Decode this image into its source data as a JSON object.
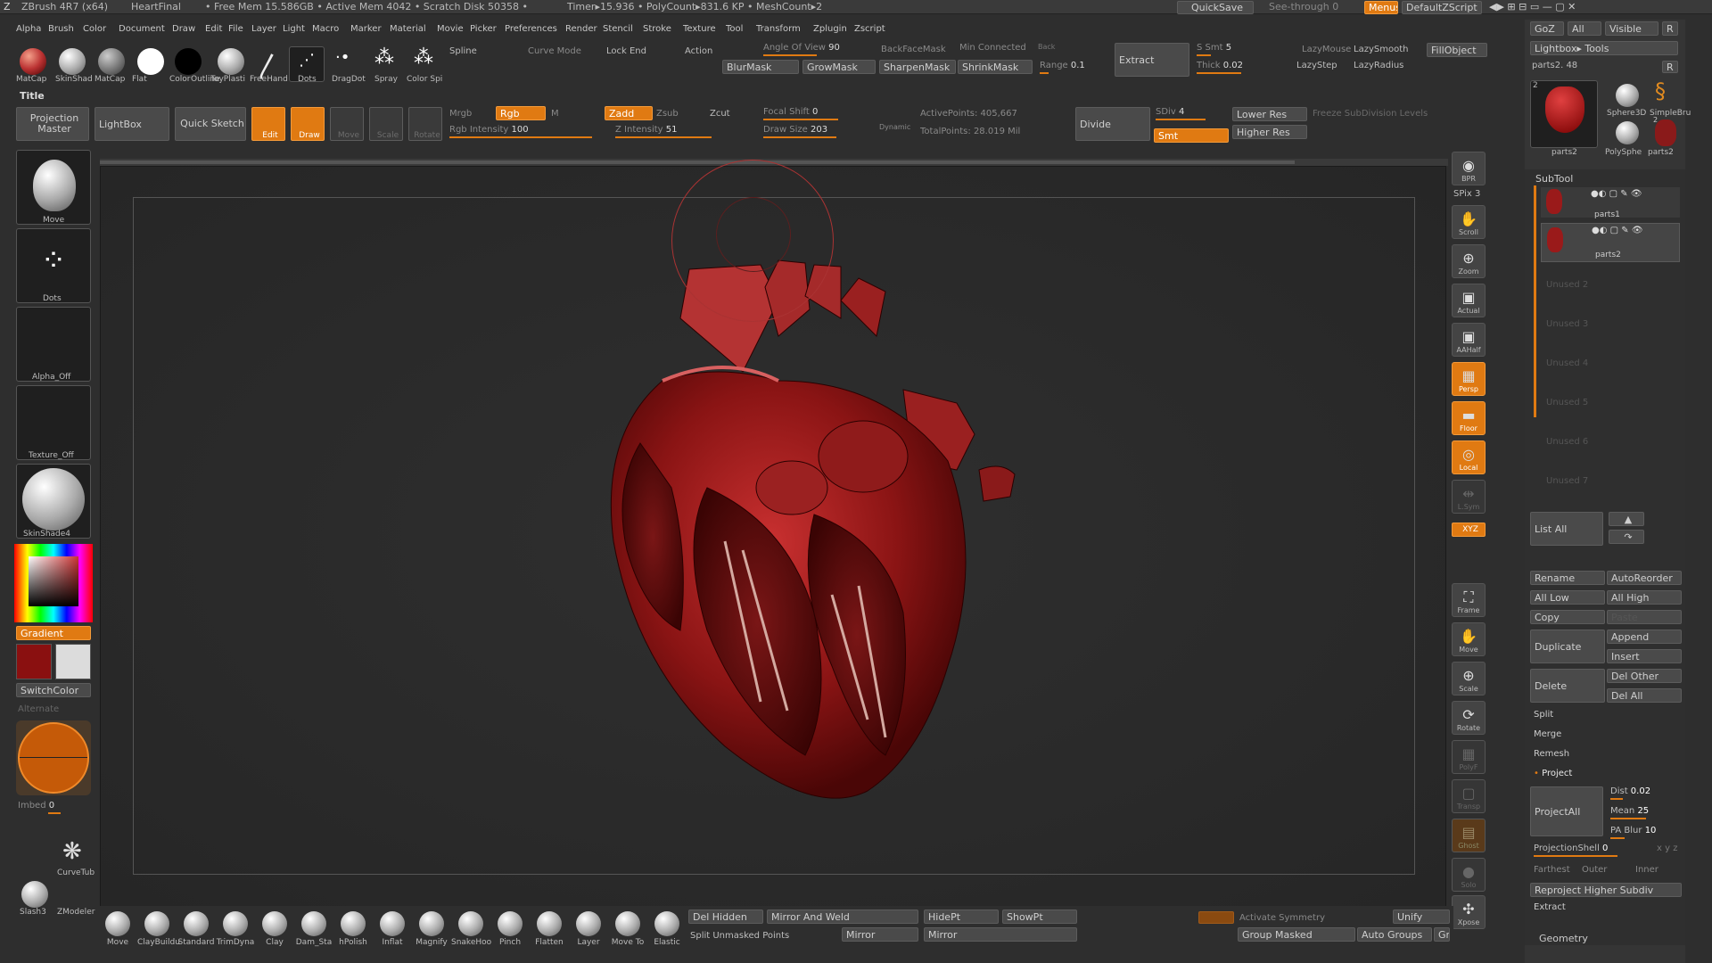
{
  "topbar": {
    "app": "ZBrush 4R7 (x64)",
    "doc": "HeartFinal",
    "mem": "• Free Mem 15.586GB • Active Mem 4042 • Scratch Disk 50358 •",
    "timer": "Timer▸15.936 • PolyCount▸831.6 KP • MeshCount▸2",
    "quicksave": "QuickSave",
    "see_through": "See-through  0",
    "menus": "Menus",
    "script": "DefaultZScript"
  },
  "menu": [
    "Alpha",
    "Brush",
    "Color",
    "Document",
    "Draw",
    "Edit",
    "File",
    "Layer",
    "Light",
    "Macro",
    "Marker",
    "Material",
    "Movie",
    "Picker",
    "Preferences",
    "Render",
    "Stencil",
    "Stroke",
    "Texture",
    "Tool",
    "Transform",
    "Zplugin",
    "Zscript"
  ],
  "shelf": {
    "items": [
      "MatCap",
      "SkinShad",
      "MatCap",
      "Flat",
      "Color",
      "Outline",
      "ToyPlasti",
      "FreeHand",
      "Dots",
      "DragDot",
      "Spray",
      "Color Spi"
    ]
  },
  "toolbar1": {
    "spline": "Spline",
    "curve_mode": "Curve Mode",
    "lock_end": "Lock End",
    "action": "Action",
    "angle": "Angle Of View",
    "angle_val": "90",
    "backface": "BackFaceMask",
    "min_conn": "Min Connected",
    "back": "Back",
    "extract": "Extract",
    "smt": "S Smt",
    "smt_val": "5",
    "lazymouse": "LazyMouse",
    "lazysmooth": "LazySmooth",
    "fillobject": "FillObject",
    "lazyradius": "LazyRadius",
    "blurmask": "BlurMask",
    "growmask": "GrowMask",
    "sharpenmask": "SharpenMask",
    "shrinkmask": "ShrinkMask",
    "range": "Range",
    "range_val": "0.1",
    "thick": "Thick",
    "thick_val": "0.02",
    "lazystep": "LazyStep"
  },
  "title_label": "Title",
  "toolbar2": {
    "projection_master": "Projection Master",
    "lightbox": "LightBox",
    "quick_sketch": "Quick Sketch",
    "edit": "Edit",
    "draw": "Draw",
    "move": "Move",
    "scale": "Scale",
    "rotate": "Rotate",
    "mrgb": "Mrgb",
    "rgb": "Rgb",
    "m": "M",
    "zadd": "Zadd",
    "zsub": "Zsub",
    "zcut": "Zcut",
    "rgb_intensity": "Rgb Intensity",
    "rgb_intensity_val": "100",
    "z_intensity": "Z Intensity",
    "z_intensity_val": "51",
    "focal_shift": "Focal Shift",
    "focal_shift_val": "0",
    "draw_size": "Draw Size",
    "draw_size_val": "203",
    "dynamic": "Dynamic",
    "active_points": "ActivePoints: 405,667",
    "total_points": "TotalPoints: 28.019 Mil",
    "divide": "Divide",
    "sdiv": "SDiv",
    "sdiv_val": "4",
    "smt": "Smt",
    "lower_res": "Lower Res",
    "higher_res": "Higher Res",
    "freeze": "Freeze SubDivision Levels"
  },
  "left": {
    "move": "Move",
    "dots": "Dots",
    "alpha": "Alpha_Off",
    "texture": "Texture_Off",
    "skinshade": "SkinShade4",
    "gradient": "Gradient",
    "switchcolor": "SwitchColor",
    "alternate": "Alternate",
    "imbed": "Imbed",
    "imbed_val": "0",
    "curvetube": "CurveTub",
    "slash3": "Slash3",
    "zmodeler": "ZModeler"
  },
  "right_nav": [
    {
      "label": "BPR",
      "icon": "◉"
    },
    {
      "label": "SPix",
      "value": "3"
    },
    {
      "label": "Scroll",
      "icon": "✋"
    },
    {
      "label": "Zoom",
      "icon": "⊕"
    },
    {
      "label": "Actual",
      "icon": "▣"
    },
    {
      "label": "AAHalf",
      "icon": "▣"
    },
    {
      "label": "Persp",
      "icon": "▦"
    },
    {
      "label": "Floor",
      "icon": "▬"
    },
    {
      "label": "Local",
      "icon": "◎"
    },
    {
      "label": "L.Sym",
      "icon": "⇹"
    },
    {
      "label": "XYZ"
    },
    {
      "label": "Frame",
      "icon": "⛶"
    },
    {
      "label": "Move",
      "icon": "✋"
    },
    {
      "label": "Scale",
      "icon": "⊕"
    },
    {
      "label": "Rotate",
      "icon": "⟳"
    },
    {
      "label": "PolyF",
      "icon": "▦"
    },
    {
      "label": "Transp",
      "icon": "▢"
    },
    {
      "label": "Ghost",
      "icon": "▤"
    },
    {
      "label": "Solo",
      "icon": "●"
    },
    {
      "label": "Xpose",
      "icon": "✣"
    }
  ],
  "tool_panel": {
    "goz": "GoZ",
    "all": "All",
    "visible": "Visible",
    "r": "R",
    "lightbox_tools": "Lightbox▸ Tools",
    "current": "parts2. 48",
    "r2": "R",
    "num2": "2",
    "num2b": "2",
    "thumbs": [
      "parts2",
      "Sphere3D",
      "SimpleBru",
      "PolySphe",
      "parts2"
    ],
    "subtool": "SubTool",
    "subtools": [
      "parts1",
      "parts2"
    ],
    "unused": [
      "Unused 2",
      "Unused 3",
      "Unused 4",
      "Unused 5",
      "Unused 6",
      "Unused 7"
    ],
    "list_all": "List All",
    "rename": "Rename",
    "autoreorder": "AutoReorder",
    "all_low": "All Low",
    "all_high": "All High",
    "copy": "Copy",
    "paste": "Paste",
    "append": "Append",
    "duplicate": "Duplicate",
    "insert": "Insert",
    "del_other": "Del Other",
    "delete": "Delete",
    "del_all": "Del All",
    "split": "Split",
    "merge": "Merge",
    "remesh": "Remesh",
    "project": "Project",
    "dist": "Dist",
    "dist_val": "0.02",
    "mean": "Mean",
    "mean_val": "25",
    "projectall": "ProjectAll",
    "pa_blur": "PA Blur",
    "pa_blur_val": "10",
    "projectionshell": "ProjectionShell",
    "projectionshell_val": "0",
    "xyz_small": "x y z",
    "farthest": "Farthest",
    "outer": "Outer",
    "inner": "Inner",
    "reproject": "Reproject Higher Subdiv",
    "extract": "Extract",
    "geometry": "Geometry"
  },
  "bottom": {
    "brushes": [
      "Move",
      "ClayBuildu",
      "Standard",
      "TrimDyna",
      "Clay",
      "Dam_Sta",
      "hPolish",
      "Inflat",
      "Magnify",
      "SnakeHoo",
      "Pinch",
      "Flatten",
      "Layer",
      "Move To",
      "Elastic"
    ],
    "del_hidden": "Del Hidden",
    "mirror_weld": "Mirror And Weld",
    "hidept": "HidePt",
    "showpt": "ShowPt",
    "split_unmasked": "Split Unmasked Points",
    "mirror": "Mirror",
    "mirror2": "Mirror",
    "activate_symmetry": "Activate Symmetry",
    "unify": "Unify",
    "group_masked": "Group Masked",
    "auto_groups": "Auto Groups",
    "gr": "Gr"
  },
  "colors": {
    "accent": "#e07a12",
    "heart": "#a01a1a"
  }
}
